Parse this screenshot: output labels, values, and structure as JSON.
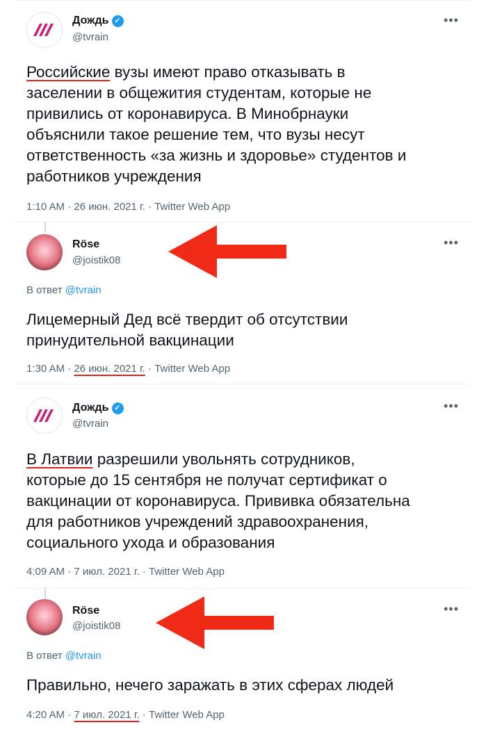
{
  "colors": {
    "accent": "#1d9bf0",
    "annotation_red": "#ef2b18",
    "muted": "#536471"
  },
  "tweets": [
    {
      "name": "Дождь",
      "handle": "@tvrain",
      "verified": true,
      "avatar_icon": "tvrain-logo-icon",
      "text_highlight": "Российские",
      "text_rest": " вузы имеют право отказывать в\nзаселении в общежития студентам, которые не\nпривились от коронавируса. В Минобрнауки\nобъяснили такое решение тем, что вузы несут\nответственность «за жизнь и здоровье» студентов и\nработников учреждения",
      "time": "1:10 AM",
      "date": "26 июн. 2021 г.",
      "source": "Twitter Web App"
    },
    {
      "name": "Röse",
      "handle": "@joistik08",
      "avatar_icon": "rose-avatar-icon",
      "reply_prefix": "В ответ",
      "reply_to": "@tvrain",
      "text": "Лицемерный Дед всё твердит об отсутствии\nпринудительной вакцинации",
      "time": "1:30 AM",
      "date": "26 июн. 2021 г.",
      "source": "Twitter Web App"
    },
    {
      "name": "Дождь",
      "handle": "@tvrain",
      "verified": true,
      "avatar_icon": "tvrain-logo-icon",
      "text_highlight": "В Латвии",
      "text_rest": " разрешили увольнять сотрудников,\nкоторые до 15 сентября не получат сертификат о\nвакцинации от коронавируса. Прививка обязательна\nдля работников учреждений здравоохранения,\nсоциального ухода и образования",
      "time": "4:09 AM",
      "date": "7 июл. 2021 г.",
      "source": "Twitter Web App"
    },
    {
      "name": "Röse",
      "handle": "@joistik08",
      "avatar_icon": "rose-avatar-icon",
      "reply_prefix": "В ответ",
      "reply_to": "@tvrain",
      "text": "Правильно, нечего заражать в этих сферах людей",
      "time": "4:20 AM",
      "date": "7 июл. 2021 г.",
      "source": "Twitter Web App"
    }
  ],
  "separator": " · ",
  "more_label": "•••"
}
